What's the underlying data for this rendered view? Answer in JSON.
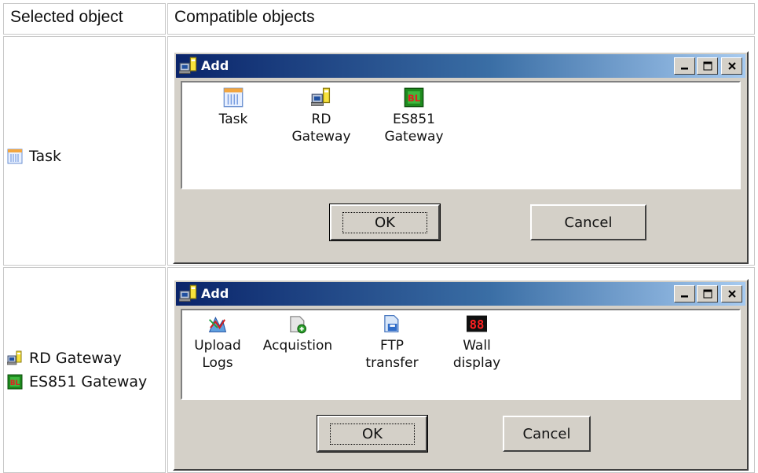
{
  "table": {
    "header_selected": "Selected object",
    "header_compatible": "Compatible objects",
    "rows": [
      {
        "selected": [
          {
            "label": "Task",
            "icon": "task-icon"
          }
        ],
        "dialog": {
          "title": "Add",
          "items": [
            {
              "label": "Task",
              "icon": "task-icon"
            },
            {
              "label": "RD\nGateway",
              "icon": "rd-gateway-icon"
            },
            {
              "label": "ES851\nGateway",
              "icon": "es851-gateway-icon"
            }
          ],
          "ok_label": "OK",
          "cancel_label": "Cancel"
        }
      },
      {
        "selected": [
          {
            "label": "RD Gateway",
            "icon": "rd-gateway-icon"
          },
          {
            "label": "ES851 Gateway",
            "icon": "es851-gateway-icon"
          }
        ],
        "dialog": {
          "title": "Add",
          "items": [
            {
              "label": "Upload\nLogs",
              "icon": "upload-logs-icon"
            },
            {
              "label": "Acquistion",
              "icon": "acquisition-icon"
            },
            {
              "label": "FTP\ntransfer",
              "icon": "ftp-transfer-icon"
            },
            {
              "label": "Wall\ndisplay",
              "icon": "wall-display-icon"
            }
          ],
          "ok_label": "OK",
          "cancel_label": "Cancel"
        }
      }
    ]
  },
  "colors": {
    "titlebar_start": "#0a246a",
    "titlebar_end": "#a6caf0",
    "dialog_face": "#d4d0c8",
    "cell_border": "#c8c8c8"
  }
}
